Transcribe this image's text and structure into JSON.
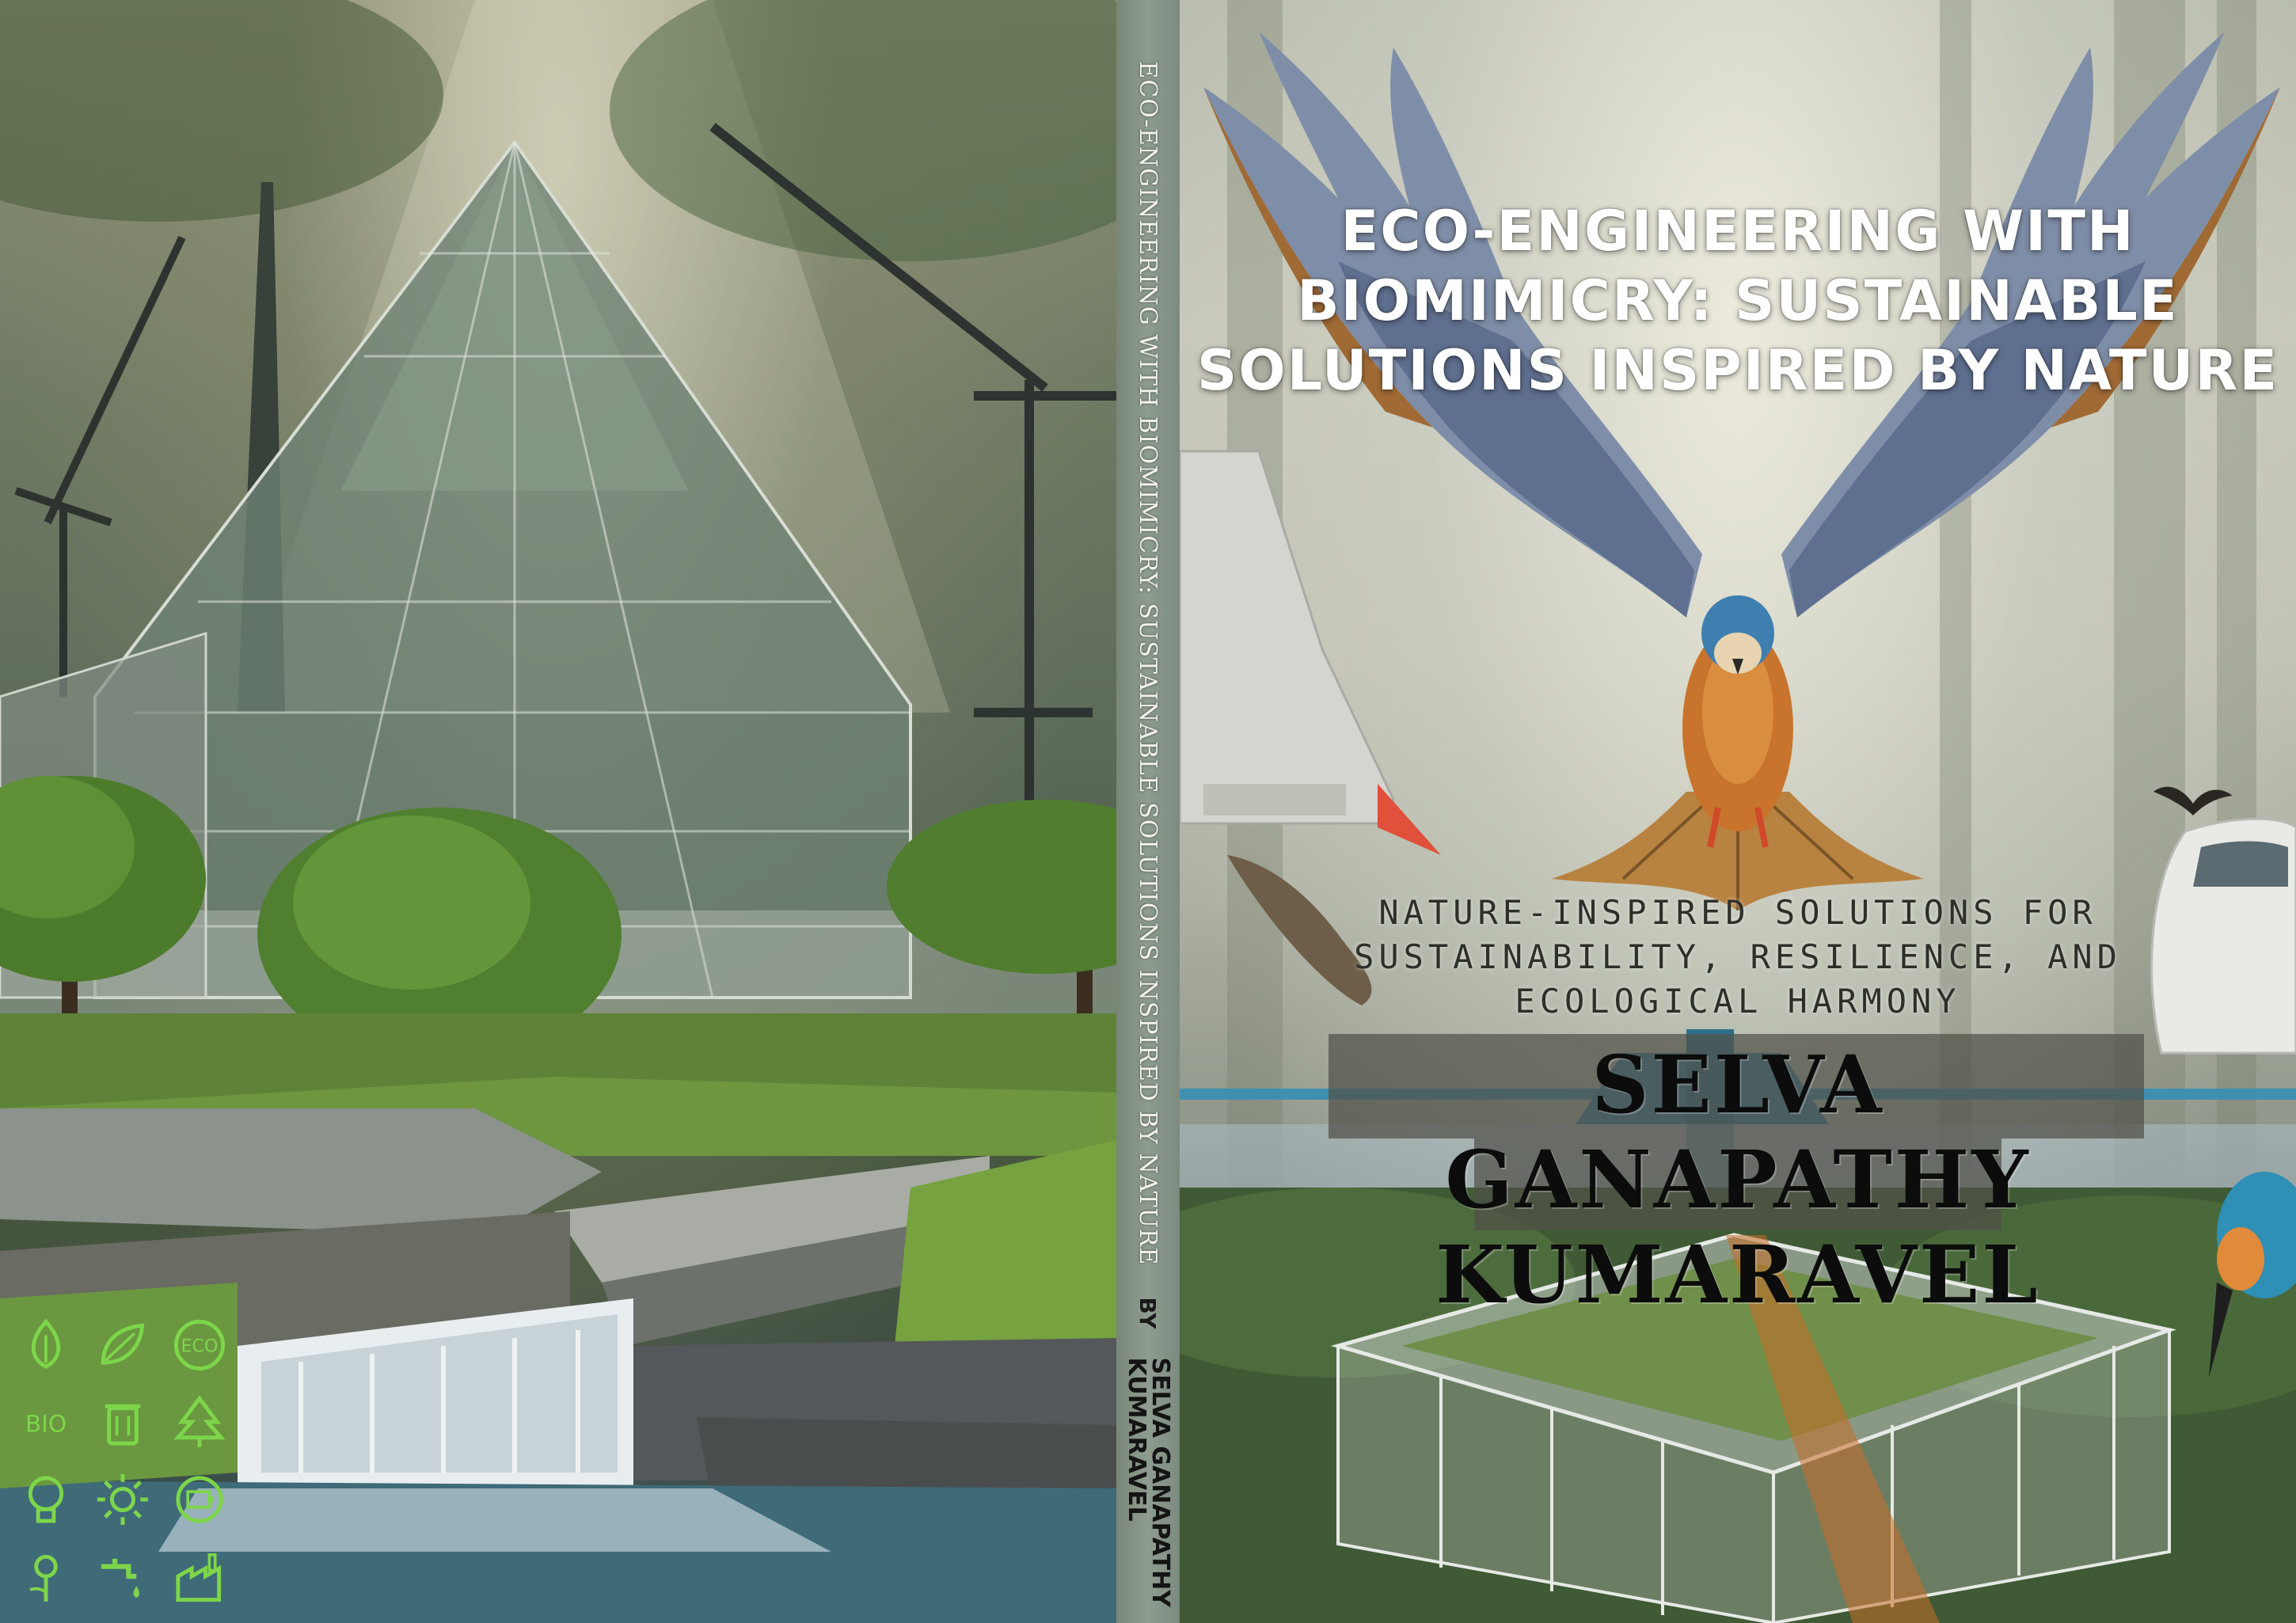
{
  "book": {
    "title": "ECO-ENGINEERING WITH BIOMIMICRY: SUSTAINABLE SOLUTIONS INSPIRED BY NATURE",
    "subtitle": "NATURE-INSPIRED SOLUTIONS FOR SUSTAINABILITY, RESILIENCE, AND ECOLOGICAL HARMONY",
    "author": "SELVA GANAPATHY KUMARAVEL",
    "author_line1": "SELVA GANAPATHY",
    "author_line2": "KUMARAVEL"
  },
  "spine": {
    "title": "ECO-ENGINEERING WITH BIOMIMICRY: SUSTAINABLE SOLUTIONS INSPIRED BY NATURE",
    "by": "BY",
    "author_line1": "SELVA GANAPATHY",
    "author_line2": "KUMARAVEL"
  },
  "back_icons": [
    {
      "name": "leaf-drop-icon"
    },
    {
      "name": "leaves-icon"
    },
    {
      "name": "eco-badge-icon",
      "label": "ECO"
    },
    {
      "name": "bio-label-icon",
      "label": "BIO"
    },
    {
      "name": "recycle-bin-icon"
    },
    {
      "name": "tree-icon"
    },
    {
      "name": "light-bulb-icon"
    },
    {
      "name": "sun-icon"
    },
    {
      "name": "battery-icon"
    },
    {
      "name": "sunflower-icon"
    },
    {
      "name": "water-tap-icon"
    },
    {
      "name": "factory-icon"
    }
  ],
  "colors": {
    "icon_green": "#7dd64a",
    "title_white": "#ffffff",
    "author_band": "#50504a"
  }
}
